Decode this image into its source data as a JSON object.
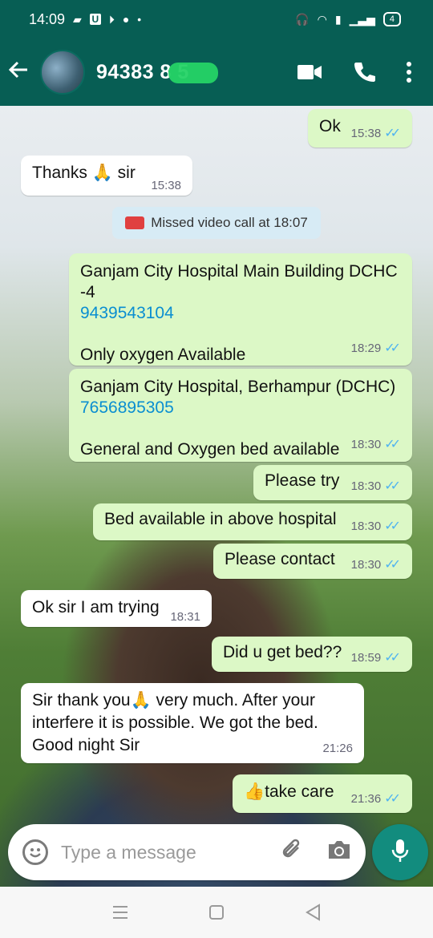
{
  "status_bar": {
    "time": "14:09",
    "battery": "4"
  },
  "header": {
    "contact_name": "94383 8  5"
  },
  "messages": [
    {
      "text": "Ok",
      "time": "15:38",
      "direction": "out"
    },
    {
      "text": "Thanks 🙏 sir",
      "time": "15:38",
      "direction": "in"
    },
    {
      "text": "Missed video call at 18:07",
      "direction": "system"
    },
    {
      "line1": "Ganjam City Hospital Main Building DCHC",
      "line2": "-4",
      "phone": "9439543104",
      "line3": "Only oxygen Available",
      "time": "18:29",
      "direction": "out"
    },
    {
      "line1": "Ganjam City Hospital, Berhampur (DCHC)",
      "phone": "7656895305",
      "line3": "General and Oxygen bed available",
      "time": "18:30",
      "direction": "out"
    },
    {
      "text": "Please try",
      "time": "18:30",
      "direction": "out"
    },
    {
      "text": "Bed available in above hospital",
      "time": "18:30",
      "direction": "out"
    },
    {
      "text": "Please contact",
      "time": "18:30",
      "direction": "out"
    },
    {
      "text": "Ok sir I am trying",
      "time": "18:31",
      "direction": "in"
    },
    {
      "text": "Did u get bed??",
      "time": "18:59",
      "direction": "out"
    },
    {
      "line1": "Sir thank you🙏 very much. After your",
      "line2": "interfere it is possible. We got the bed.",
      "line3": "Good night Sir",
      "time": "21:26",
      "direction": "in"
    },
    {
      "text": "👍take care",
      "time": "21:36",
      "direction": "out"
    }
  ],
  "composer": {
    "placeholder": "Type a message"
  },
  "colors": {
    "header": "#075e54",
    "outgoing_bubble": "#dcf8c6",
    "read_ticks": "#4fb3f0",
    "mic_button": "#128c7e"
  },
  "icons": [
    "back-arrow-icon",
    "video-call-icon",
    "phone-call-icon",
    "more-options-icon",
    "emoji-icon",
    "attach-icon",
    "camera-icon",
    "mic-icon"
  ]
}
